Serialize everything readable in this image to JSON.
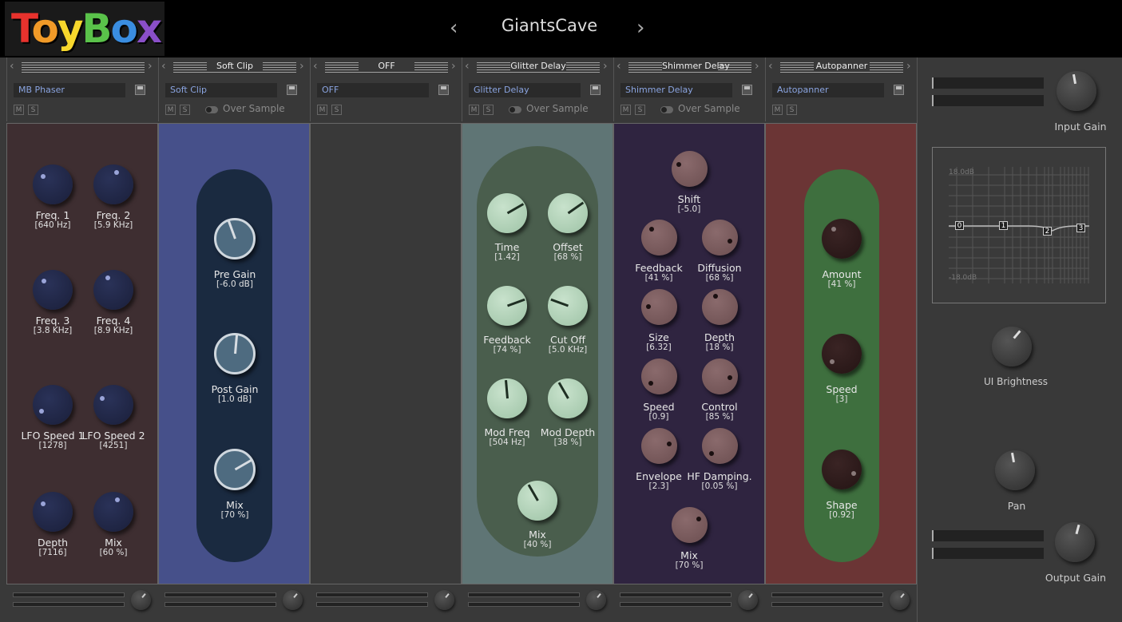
{
  "app": {
    "logo_text": "ToyBox",
    "preset_name": "GiantsCave"
  },
  "colors": {
    "logo": [
      "#e8322d",
      "#f09a28",
      "#f7d72c",
      "#5ac24a",
      "#3a8de0",
      "#8a4fc8"
    ]
  },
  "slots": [
    {
      "header": "",
      "select": "MB Phaser",
      "oversample": false
    },
    {
      "header": "Soft Clip",
      "select": "Soft Clip",
      "oversample": true
    },
    {
      "header": "OFF",
      "select": "OFF",
      "oversample": false
    },
    {
      "header": "Glitter Delay",
      "select": "Glitter Delay",
      "oversample": true
    },
    {
      "header": "Shimmer Delay",
      "select": "Shimmer Delay",
      "oversample": true
    },
    {
      "header": "Autopanner",
      "select": "Autopanner",
      "oversample": false
    }
  ],
  "common": {
    "mute": "M",
    "solo": "S",
    "oversample_label": "Over Sample"
  },
  "phaser": [
    {
      "label": "Freq. 1",
      "value": "[640 Hz]"
    },
    {
      "label": "Freq. 2",
      "value": "[5.9 KHz]"
    },
    {
      "label": "Freq. 3",
      "value": "[3.8 KHz]"
    },
    {
      "label": "Freq. 4",
      "value": "[8.9 KHz]"
    },
    {
      "label": "LFO Speed 1",
      "value": "[1278]"
    },
    {
      "label": "LFO Speed 2",
      "value": "[4251]"
    },
    {
      "label": "Depth",
      "value": "[7116]"
    },
    {
      "label": "Mix",
      "value": "[60 %]"
    }
  ],
  "softclip": [
    {
      "label": "Pre Gain",
      "value": "[-6.0 dB]"
    },
    {
      "label": "Post Gain",
      "value": "[1.0 dB]"
    },
    {
      "label": "Mix",
      "value": "[70 %]"
    }
  ],
  "glitter": [
    {
      "label": "Time",
      "value": "[1.42]"
    },
    {
      "label": "Offset",
      "value": "[68 %]"
    },
    {
      "label": "Feedback",
      "value": "[74 %]"
    },
    {
      "label": "Cut Off",
      "value": "[5.0 KHz]"
    },
    {
      "label": "Mod Freq",
      "value": "[504 Hz]"
    },
    {
      "label": "Mod Depth",
      "value": "[38 %]"
    },
    {
      "label": "Mix",
      "value": "[40 %]"
    }
  ],
  "shimmer": [
    {
      "label": "Shift",
      "value": "[-5.0]"
    },
    {
      "label": "Feedback",
      "value": "[41 %]"
    },
    {
      "label": "Diffusion",
      "value": "[68 %]"
    },
    {
      "label": "Size",
      "value": "[6.32]"
    },
    {
      "label": "Depth",
      "value": "[18 %]"
    },
    {
      "label": "Speed",
      "value": "[0.9]"
    },
    {
      "label": "Control",
      "value": "[85 %]"
    },
    {
      "label": "Envelope",
      "value": "[2.3]"
    },
    {
      "label": "HF Damping.",
      "value": "[0.05 %]"
    },
    {
      "label": "Mix",
      "value": "[70 %]"
    }
  ],
  "autopan": [
    {
      "label": "Amount",
      "value": "[41 %]"
    },
    {
      "label": "Speed",
      "value": "[3]"
    },
    {
      "label": "Shape",
      "value": "[0.92]"
    }
  ],
  "right": {
    "input_gain": "Input Gain",
    "eq_top": "18.0dB",
    "eq_bottom": "-18.0dB",
    "eq_nodes": [
      "0",
      "1",
      "2",
      "3"
    ],
    "ui_brightness": "UI Brightness",
    "pan": "Pan",
    "output_gain": "Output Gain"
  }
}
